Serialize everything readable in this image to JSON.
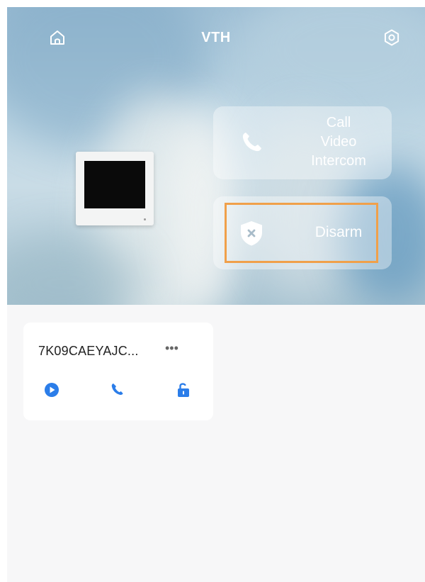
{
  "header": {
    "title": "VTH",
    "left_icon": "home-icon",
    "right_icon": "settings-icon"
  },
  "actions": {
    "call": {
      "label_lines": [
        "Call",
        "Video",
        "Intercom"
      ],
      "icon": "phone-icon"
    },
    "disarm": {
      "label": "Disarm",
      "icon": "shield-x-icon",
      "highlighted": true
    }
  },
  "device_card": {
    "name": "7K09CAEYAJC...",
    "more_label": "•••",
    "buttons": [
      {
        "icon": "play-icon"
      },
      {
        "icon": "phone-icon"
      },
      {
        "icon": "unlock-icon"
      }
    ]
  },
  "colors": {
    "accent": "#2b7de9",
    "highlight": "#f0a04a",
    "text_primary": "#222222",
    "white": "#ffffff"
  }
}
